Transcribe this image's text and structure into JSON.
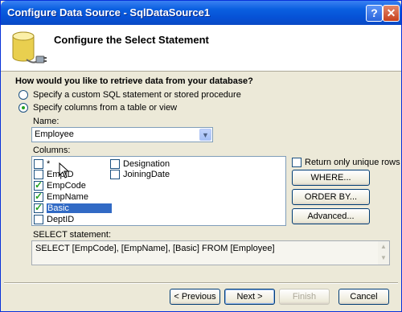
{
  "window": {
    "title": "Configure Data Source - SqlDataSource1",
    "help_label": "?",
    "close_label": "✕"
  },
  "banner": {
    "title": "Configure the Select Statement"
  },
  "question": "How would you like to retrieve data from your database?",
  "options": [
    {
      "label": "Specify a custom SQL statement or stored procedure",
      "checked": false
    },
    {
      "label": "Specify columns from a table or view",
      "checked": true
    }
  ],
  "name": {
    "label": "Name:",
    "value": "Employee"
  },
  "columns": {
    "label": "Columns:",
    "items": [
      {
        "text": "*",
        "checked": false,
        "selected": false
      },
      {
        "text": "EmpID",
        "checked": false,
        "selected": false
      },
      {
        "text": "EmpCode",
        "checked": true,
        "selected": false
      },
      {
        "text": "EmpName",
        "checked": true,
        "selected": false
      },
      {
        "text": "Basic",
        "checked": true,
        "selected": true
      },
      {
        "text": "DeptID",
        "checked": false,
        "selected": false
      },
      {
        "text": "Designation",
        "checked": false,
        "selected": false
      },
      {
        "text": "JoiningDate",
        "checked": false,
        "selected": false
      }
    ]
  },
  "unique_rows": {
    "label": "Return only unique rows",
    "checked": false
  },
  "side_buttons": {
    "where": "WHERE...",
    "order_by": "ORDER BY...",
    "advanced": "Advanced..."
  },
  "sql": {
    "label": "SELECT statement:",
    "value": "SELECT [EmpCode], [EmpName], [Basic] FROM [Employee]"
  },
  "footer": {
    "previous": "< Previous",
    "next": "Next >",
    "finish": "Finish",
    "cancel": "Cancel"
  },
  "icons": {
    "db": "database-connector-icon",
    "cursor": "mouse-cursor-icon"
  }
}
